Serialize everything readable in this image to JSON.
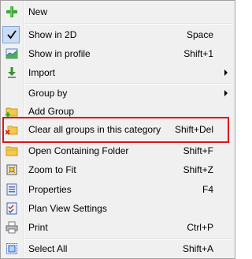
{
  "menu": {
    "items": [
      {
        "label": "New",
        "shortcut": "",
        "icon": "plus-icon",
        "submenu": false
      },
      {
        "label": "Show in 2D",
        "shortcut": "Space",
        "icon": "checkmark-icon",
        "submenu": false,
        "checked": true
      },
      {
        "label": "Show in profile",
        "shortcut": "Shift+1",
        "icon": "profile-chart-icon",
        "submenu": false
      },
      {
        "label": "Import",
        "shortcut": "",
        "icon": "import-icon",
        "submenu": true
      },
      {
        "label": "Group by",
        "shortcut": "",
        "icon": "",
        "submenu": true
      },
      {
        "label": "Add Group",
        "shortcut": "",
        "icon": "add-folder-icon",
        "submenu": false
      },
      {
        "label": "Clear all groups in this category",
        "shortcut": "Shift+Del",
        "icon": "clear-folder-icon",
        "submenu": false
      },
      {
        "label": "Open Containing Folder",
        "shortcut": "Shift+F",
        "icon": "folder-icon",
        "submenu": false
      },
      {
        "label": "Zoom to Fit",
        "shortcut": "Shift+Z",
        "icon": "zoom-fit-icon",
        "submenu": false
      },
      {
        "label": "Properties",
        "shortcut": "F4",
        "icon": "properties-icon",
        "submenu": false
      },
      {
        "label": "Plan View Settings",
        "shortcut": "",
        "icon": "plan-view-settings-icon",
        "submenu": false
      },
      {
        "label": "Print",
        "shortcut": "Ctrl+P",
        "icon": "printer-icon",
        "submenu": false
      },
      {
        "label": "Select All",
        "shortcut": "Shift+A",
        "icon": "select-all-icon",
        "submenu": false
      }
    ]
  },
  "colors": {
    "highlight_border": "#e0141b",
    "menu_background": "#f0f0f0",
    "checked_background": "#c9def5"
  }
}
